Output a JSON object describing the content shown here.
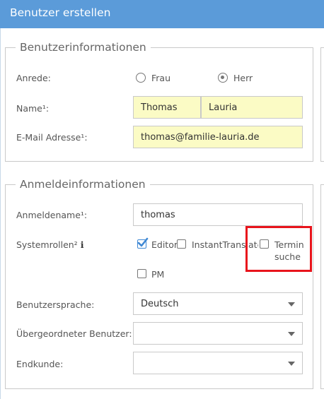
{
  "window": {
    "title": "Benutzer erstellen"
  },
  "user_info": {
    "legend": "Benutzerinformationen",
    "salutation_label": "Anrede:",
    "salutation_options": [
      "Frau",
      "Herr"
    ],
    "salutation_selected": "Herr",
    "name_label": "Name¹:",
    "first_name": "Thomas",
    "last_name": "Lauria",
    "email_label": "E-Mail Adresse¹:",
    "email": "thomas@familie-lauria.de"
  },
  "login_info": {
    "legend": "Anmeldeinformationen",
    "login_name_label": "Anmeldename¹:",
    "login_name": "thomas",
    "roles_label": "Systemrollen²",
    "roles_info_icon": "ℹ",
    "roles": [
      {
        "label": "Editor",
        "checked": true
      },
      {
        "label": "InstantTranslate",
        "checked": false
      },
      {
        "label_line1": "Termin",
        "label_line2": "suche",
        "checked": false
      },
      {
        "label": "PM",
        "checked": false
      }
    ],
    "language_label": "Benutzersprache:",
    "language": "Deutsch",
    "parent_user_label": "Übergeordneter Benutzer:",
    "parent_user": "",
    "end_customer_label": "Endkunde:",
    "end_customer": ""
  },
  "colors": {
    "titlebar": "#5b9bd9",
    "required_field": "#fbfbc5",
    "highlight": "#e8141c",
    "checkbox_checked": "#3f88d4"
  }
}
